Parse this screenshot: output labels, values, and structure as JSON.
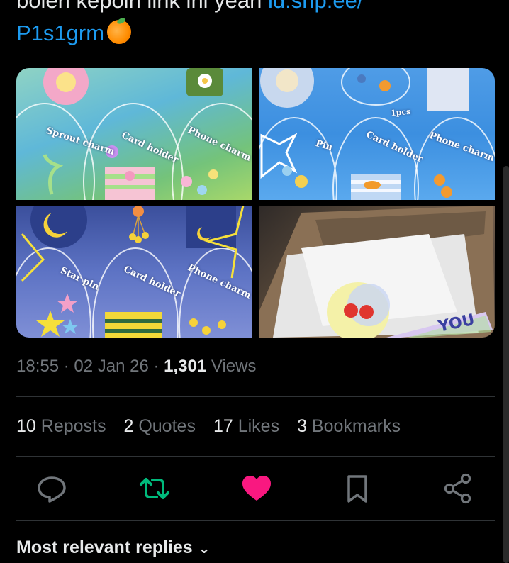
{
  "tweet": {
    "text_line1": "bolen kepoin link ini yeah ",
    "link_line1": "id.shp.ee/",
    "link_line2": "P1s1grm"
  },
  "media": {
    "tile1": {
      "labels": [
        "Sprout charm",
        "Card holder",
        "Phone charm"
      ]
    },
    "tile2": {
      "labels": [
        "Pin",
        "Card holder",
        "Phone charm",
        "1pcs"
      ]
    },
    "tile3": {
      "labels": [
        "Star pin",
        "Card holder",
        "Phone charm"
      ]
    },
    "tile4": {
      "labels": []
    }
  },
  "meta": {
    "time": "18:55",
    "sep1": " · ",
    "date": "02 Jan 26",
    "sep2": " · ",
    "views_count": "1,301",
    "views_label": " Views"
  },
  "stats": {
    "reposts_count": "10",
    "reposts_label": " Reposts",
    "quotes_count": "2",
    "quotes_label": " Quotes",
    "likes_count": "17",
    "likes_label": " Likes",
    "bookmarks_count": "3",
    "bookmarks_label": " Bookmarks"
  },
  "actions": {
    "reply_icon": "reply-icon",
    "repost_icon": "repost-icon",
    "like_icon": "heart-icon",
    "bookmark_icon": "bookmark-icon",
    "share_icon": "share-icon"
  },
  "replies": {
    "header": "Most relevant replies",
    "chevron": "⌄"
  },
  "colors": {
    "link": "#1d9bf0",
    "repost_green": "#00ba7c",
    "like_pink": "#f91880",
    "muted": "#71767b",
    "text": "#e7e9ea"
  }
}
